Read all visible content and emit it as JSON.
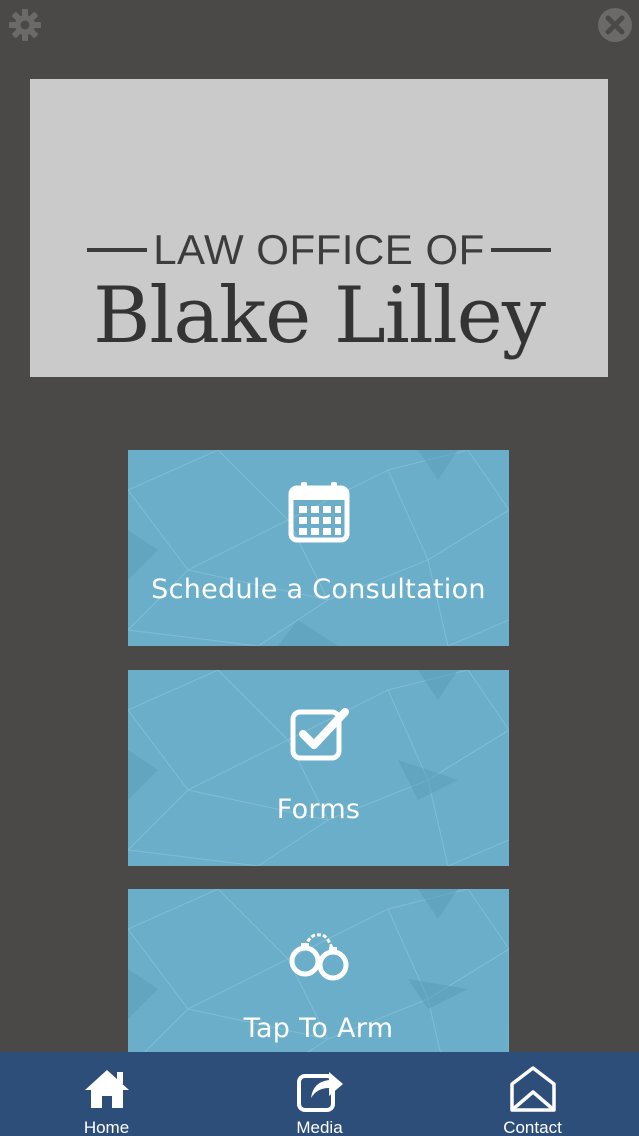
{
  "top_bar": {
    "settings_icon": "gear-icon",
    "close_icon": "close-icon"
  },
  "logo": {
    "line1": "LAW OFFICE OF",
    "line2": "Blake Lilley"
  },
  "tiles": [
    {
      "label": "Schedule a Consultation",
      "icon": "calendar-icon"
    },
    {
      "label": "Forms",
      "icon": "checkbox-icon"
    },
    {
      "label": "Tap To Arm",
      "icon": "handcuffs-icon"
    }
  ],
  "tabbar": {
    "items": [
      {
        "label": "Home",
        "icon": "home-icon"
      },
      {
        "label": "Media",
        "icon": "share-icon"
      },
      {
        "label": "Contact",
        "icon": "envelope-icon"
      }
    ]
  },
  "colors": {
    "background": "#4a4948",
    "logo_bg": "#cbcacb",
    "tile": "#6aaec9",
    "tabbar": "#2e4e7a"
  }
}
